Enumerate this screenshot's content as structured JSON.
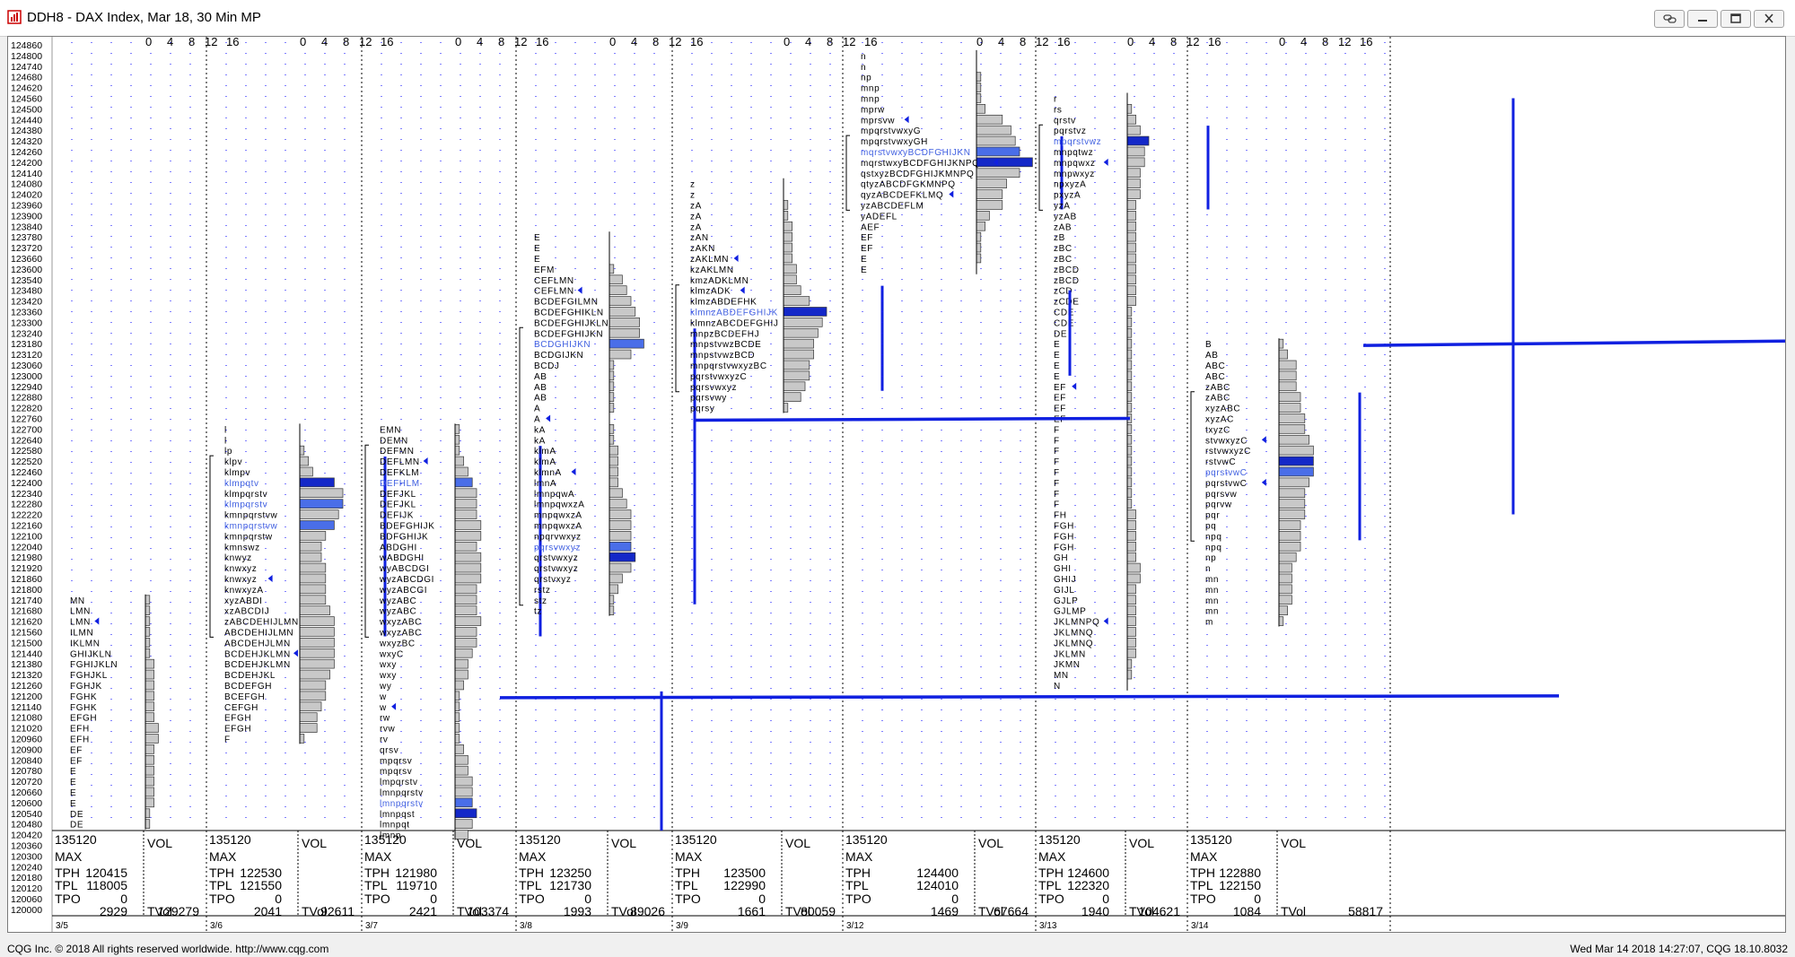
{
  "window": {
    "title": "DDH8 - DAX Index, Mar 18, 30 Min MP",
    "buttons": [
      "link-icon",
      "minimize-icon",
      "restore-icon",
      "close-icon"
    ]
  },
  "footer": {
    "copyright": "CQG Inc. © 2018 All rights reserved worldwide. http://www.cqg.com",
    "timestamp": "Wed Mar 14 2018 14:27:07, CQG 18.10.8032"
  },
  "colors": {
    "tpo_text": "#000000",
    "value_area_text": "#4060e0",
    "poc_bar": "#1428c8",
    "value_area_bar": "#4a6ee8",
    "histogram_bar": "#c8c8c8",
    "range_line": "#1020e0",
    "grid_dot": "#1a1aff"
  },
  "chart_data": {
    "type": "market_profile",
    "instrument": "DDH8 - DAX Index",
    "price_axis": {
      "min": 120420,
      "max": 124860,
      "step": 60,
      "labels": [
        "124860",
        "124800",
        "124740",
        "124680",
        "124620",
        "124560",
        "124500",
        "124440",
        "124380",
        "124320",
        "124260",
        "124200",
        "124140",
        "124080",
        "124020",
        "123960",
        "123900",
        "123840",
        "123780",
        "123720",
        "123660",
        "123600",
        "123540",
        "123480",
        "123420",
        "123360",
        "123300",
        "123240",
        "123180",
        "123120",
        "123060",
        "123000",
        "122940",
        "122880",
        "122820",
        "122760",
        "122700",
        "122640",
        "122580",
        "122520",
        "122460",
        "122400",
        "122340",
        "122280",
        "122220",
        "122160",
        "122100",
        "122040",
        "121980",
        "121920",
        "121860",
        "121800",
        "121740",
        "121680",
        "121620",
        "121560",
        "121500",
        "121440",
        "121380",
        "121320",
        "121260",
        "121200",
        "121140",
        "121080",
        "121020",
        "120960",
        "120900",
        "120840",
        "120780",
        "120720",
        "120660",
        "120600",
        "120540",
        "120480",
        "120420",
        "120360",
        "120300",
        "120240",
        "120180",
        "120120",
        "120060",
        "120000"
      ]
    },
    "volume_scale_labels": [
      "0",
      "4",
      "8",
      "12",
      "16"
    ],
    "volume_scale_max": 20,
    "sessions": [
      {
        "date": "3/5",
        "top_price": 121740,
        "tpo_rows": [
          "MN",
          "LMN",
          "LMN",
          "ILMN",
          "IKLMN",
          "GHIJKLN",
          "FGHIJKLN",
          "FGHJKL",
          "FGHJK",
          "FGHK",
          "FGHK",
          "EFGH",
          "EFH",
          "EFH",
          "EF",
          "EF",
          "E",
          "E",
          "E",
          "E",
          "DE",
          "DE"
        ],
        "volume": [
          1,
          1,
          1,
          1,
          1,
          1,
          2,
          2,
          2,
          2,
          2,
          2,
          3,
          3,
          2,
          2,
          2,
          2,
          2,
          2,
          1,
          1
        ],
        "value_area_rows": [],
        "poc_row": -1,
        "marker_rows": [
          2
        ],
        "va_bracket": null,
        "stats": {
          "price": "135120",
          "max_label": "MAX",
          "tph": "120415",
          "tpl": "118005",
          "tpo": "0",
          "tpo_count": "2929",
          "vol_label": "VOL",
          "tvol_label": "TVol",
          "tvol": "129279"
        }
      },
      {
        "date": "3/6",
        "top_price": 122700,
        "tpo_rows": [
          "l",
          "l",
          "lp",
          "klpv",
          "klmpv",
          "klmpqtv",
          "klmpqrstv",
          "klmpqrstv",
          "kmnpqrstvw",
          "kmnpqrstvw",
          "kmnpqrstw",
          "kmnswz",
          "knwyz",
          "knwxyz",
          "knwxyz",
          "knwxyzA",
          "xyzABDI",
          "xzABCDIJ",
          "zABCDEHIJLMN",
          "ABCDEHIJLMN",
          "ABCDEHJLMN",
          "BCDEHJKLMN",
          "BCDEHJKLMN",
          "BCDEHJKL",
          "BCDEFGH",
          "BCEFGH",
          "CEFGH",
          "EFGH",
          "EFGH",
          "F"
        ],
        "volume": [
          0,
          0,
          1,
          2,
          3,
          8,
          10,
          10,
          9,
          8,
          6,
          5,
          5,
          6,
          6,
          6,
          6,
          7,
          8,
          8,
          8,
          8,
          8,
          7,
          6,
          6,
          5,
          4,
          4,
          1
        ],
        "value_area_rows": [
          5,
          7,
          9
        ],
        "poc_row": 5,
        "marker_rows": [
          14,
          21
        ],
        "va_bracket": [
          122520,
          121560
        ],
        "stats": {
          "price": "135120",
          "max_label": "MAX",
          "tph": "122530",
          "tpl": "121550",
          "tpo": "0",
          "tpo_count": "2041",
          "vol_label": "VOL",
          "tvol_label": "TVol",
          "tvol": "92611"
        }
      },
      {
        "date": "3/7",
        "top_price": 122700,
        "tpo_rows": [
          "EMN",
          "DEMN",
          "DEFMN",
          "DEFLMN",
          "DEFKLM",
          "DEFHLM",
          "DEFJKL",
          "DEFJKL",
          "DEFIJK",
          "BDEFGHIJK",
          "BDFGHIJK",
          "ABDGHI",
          "wABDGHI",
          "wyABCDGI",
          "wyzABCDGI",
          "wyzABCGI",
          "wyzABC",
          "wyzABC",
          "wxyzABC",
          "wxyzABC",
          "wxyzBC",
          "wxyC",
          "wxy",
          "wxy",
          "wy",
          "w",
          "w",
          "rw",
          "rvw",
          "rv",
          "qrsv",
          "mpqrsv",
          "mpqrsv",
          "lmpqrstv",
          "lmnpqrstv",
          "lmnpqrstv",
          "lmnpqst",
          "lmnpqt",
          "lmnp"
        ],
        "volume": [
          1,
          1,
          1,
          2,
          3,
          4,
          5,
          5,
          5,
          6,
          6,
          5,
          6,
          6,
          6,
          5,
          5,
          5,
          6,
          5,
          5,
          4,
          3,
          3,
          2,
          1,
          1,
          1,
          1,
          1,
          2,
          3,
          3,
          4,
          4,
          4,
          5,
          4,
          3
        ],
        "value_area_rows": [
          5,
          35
        ],
        "poc_row": 36,
        "marker_rows": [
          3,
          26
        ],
        "va_bracket": [
          122580,
          121560
        ],
        "stats": {
          "price": "135120",
          "max_label": "MAX",
          "tph": "121980",
          "tpl": "119710",
          "tpo": "0",
          "tpo_count": "2421",
          "vol_label": "VOL",
          "tvol_label": "TVol",
          "tvol": "103374"
        }
      },
      {
        "date": "3/8",
        "top_price": 123780,
        "tpo_rows": [
          "E",
          "E",
          "E",
          "EFM",
          "CEFLMN",
          "CEFLMN",
          "BCDEFGILMN",
          "BCDEFGHIKLN",
          "BCDEFGHIJKLN",
          "BCDEFGHIJKN",
          "BCDGHIJKN",
          "BCDGIJKN",
          "BCDJ",
          "AB",
          "AB",
          "AB",
          "A",
          "A",
          "kA",
          "kA",
          "klmA",
          "klmA",
          "klmnA",
          "lmnA",
          "lmnpqwA",
          "lmnpqwxzA",
          "mnpqwxzA",
          "mnpqwxzA",
          "npqrvwxyz",
          "pqrsvwxyz",
          "qrstvwxyz",
          "qrstvwxyz",
          "qrstvxyz",
          "rstz",
          "stz",
          "tz"
        ],
        "volume": [
          0,
          0,
          0,
          1,
          3,
          4,
          5,
          6,
          7,
          7,
          8,
          5,
          1,
          1,
          1,
          1,
          1,
          0,
          1,
          1,
          2,
          2,
          2,
          2,
          3,
          4,
          5,
          5,
          5,
          5,
          6,
          5,
          3,
          2,
          1,
          1
        ],
        "value_area_rows": [
          10,
          29
        ],
        "poc_row": 30,
        "marker_rows": [
          5,
          17,
          22
        ],
        "va_bracket": [
          123240,
          121740
        ],
        "stats": {
          "price": "135120",
          "max_label": "MAX",
          "tph": "123250",
          "tpl": "121730",
          "tpo": "0",
          "tpo_count": "1993",
          "vol_label": "VOL",
          "tvol_label": "TVol",
          "tvol": "89026"
        }
      },
      {
        "date": "3/9",
        "top_price": 124080,
        "tpo_rows": [
          "z",
          "z",
          "zA",
          "zA",
          "zA",
          "zAN",
          "zAKN",
          "zAKLMN",
          "kzAKLMN",
          "kmzADKLMN",
          "klmzADK",
          "klmzABDEFHK",
          "klmnzABDEFGHIJK",
          "klmnzABCDEFGHIJ",
          "mnpzBCDEFHJ",
          "mnpstvwzBCDE",
          "mnpstvwzBCD",
          "mnpqrstvwxyzBC",
          "pqrstvwxyzC",
          "pqrsvwxyz",
          "pqrsvwy",
          "pqrsy"
        ],
        "volume": [
          0,
          0,
          1,
          1,
          2,
          2,
          2,
          2,
          3,
          3,
          4,
          6,
          10,
          9,
          8,
          7,
          7,
          6,
          6,
          5,
          4,
          1
        ],
        "value_area_rows": [
          12
        ],
        "poc_row": 12,
        "marker_rows": [
          7,
          10
        ],
        "va_bracket": [
          123480,
          122940
        ],
        "stats": {
          "price": "135120",
          "max_label": "MAX",
          "tph": "123500",
          "tpl": "122990",
          "tpo": "0",
          "tpo_count": "1661",
          "vol_label": "VOL",
          "tvol_label": "TVol",
          "tvol": "80059"
        }
      },
      {
        "date": "3/12",
        "top_price": 124800,
        "tpo_rows": [
          "n",
          "n",
          "np",
          "mnp",
          "mnp",
          "mprw",
          "mprsvw",
          "mpqrstvwxyG",
          "mpqrstvwxyGH",
          "mqrstvwxyBCDFGHIJKN",
          "mqrstwxyBCDFGHIJKNPQ",
          "qstxyzBCDFGHIJKMNPQ",
          "qtyzABCDFGKMNPQ",
          "qyzABCDEFKLMQ",
          "yzABCDEFLM",
          "yADEFL",
          "AEF",
          "EF",
          "EF",
          "E",
          "E"
        ],
        "volume": [
          0,
          0,
          1,
          1,
          1,
          2,
          6,
          8,
          9,
          10,
          13,
          10,
          7,
          6,
          6,
          3,
          2,
          1,
          1,
          1,
          0
        ],
        "value_area_rows": [
          9
        ],
        "poc_row": 10,
        "marker_rows": [
          6,
          10,
          13
        ],
        "va_bracket": [
          124320,
          123960
        ],
        "stats": {
          "price": "135120",
          "max_label": "MAX",
          "tph": "124400",
          "tpl": "124010",
          "tpo": "0",
          "tpo_count": "1469",
          "vol_label": "VOL",
          "tvol_label": "TVol",
          "tvol": "67664"
        }
      },
      {
        "date": "3/13",
        "top_price": 124560,
        "tpo_rows": [
          "r",
          "rs",
          "qrstv",
          "pqrstvz",
          "mpqrstvwz",
          "mnpqtwz",
          "mnpqwxz",
          "mnpwxyz",
          "npxyzA",
          "pxyzA",
          "yzA",
          "yzAB",
          "zAB",
          "zB",
          "zBC",
          "zBC",
          "zBCD",
          "zBCD",
          "zCD",
          "zCDE",
          "CDE",
          "CDE",
          "DE",
          "E",
          "E",
          "E",
          "E",
          "EF",
          "EF",
          "EF",
          "EF",
          "F",
          "F",
          "F",
          "F",
          "F",
          "F",
          "F",
          "F",
          "FH",
          "FGH",
          "FGH",
          "FGH",
          "GH",
          "GHI",
          "GHIJ",
          "GIJL",
          "GJLP",
          "GJLMP",
          "JKLMNPQ",
          "JKLMNQ",
          "JKLMNQ",
          "JKLMN",
          "JKMN",
          "MN",
          "N"
        ],
        "volume": [
          0,
          1,
          2,
          3,
          5,
          4,
          4,
          3,
          3,
          3,
          2,
          2,
          2,
          2,
          2,
          2,
          2,
          2,
          2,
          2,
          1,
          1,
          1,
          1,
          1,
          1,
          1,
          1,
          1,
          1,
          1,
          1,
          1,
          1,
          1,
          1,
          1,
          1,
          1,
          2,
          2,
          2,
          2,
          2,
          3,
          3,
          2,
          2,
          2,
          2,
          2,
          2,
          2,
          1,
          1,
          0
        ],
        "value_area_rows": [
          4
        ],
        "poc_row": 4,
        "marker_rows": [
          6,
          27,
          49
        ],
        "va_bracket": [
          124380,
          123960
        ],
        "stats": {
          "price": "135120",
          "max_label": "MAX",
          "tph": "124600",
          "tpl": "122320",
          "tpo": "0",
          "tpo_count": "1940",
          "vol_label": "VOL",
          "tvol_label": "TVol",
          "tvol": "104621"
        }
      },
      {
        "date": "3/14",
        "top_price": 123180,
        "tpo_rows": [
          "B",
          "AB",
          "ABC",
          "ABC",
          "zABC",
          "zABC",
          "xyzABC",
          "xyzAC",
          "txyzC",
          "stvwxyzC",
          "rstvwxyzC",
          "rstvwC",
          "pqrstvwC",
          "pqrstvwC",
          "pqrsvw",
          "pqrvw",
          "pqr",
          "pq",
          "npq",
          "npq",
          "np",
          "n",
          "mn",
          "mn",
          "mn",
          "mn",
          "m"
        ],
        "volume": [
          1,
          2,
          4,
          4,
          4,
          5,
          5,
          6,
          6,
          7,
          8,
          8,
          8,
          7,
          6,
          6,
          6,
          5,
          5,
          5,
          4,
          3,
          3,
          3,
          3,
          2,
          1
        ],
        "value_area_rows": [
          12
        ],
        "poc_row": 11,
        "marker_rows": [
          9,
          13
        ],
        "va_bracket": [
          122880,
          122100
        ],
        "stats": {
          "price": "135120",
          "max_label": "MAX",
          "tph": "122880",
          "tpl": "122150",
          "tpo": "0",
          "tpo_count": "1084",
          "vol_label": "VOL",
          "tvol_label": "TVol",
          "tvol": "58817"
        }
      }
    ],
    "range_lines": [
      {
        "y_price": 122760,
        "from_date": "3/8",
        "to_date": "3/12"
      },
      {
        "y_price": 121200,
        "from_date": "3/7",
        "to_date": "3/13"
      },
      {
        "y_price": 123180,
        "from_date": "3/13",
        "to_date": "3/14"
      }
    ],
    "session_range_lines": [
      {
        "date": "3/7",
        "high": 121200,
        "low": 120420
      },
      {
        "date": "3/13",
        "high": 124560,
        "low": 122220
      }
    ]
  }
}
